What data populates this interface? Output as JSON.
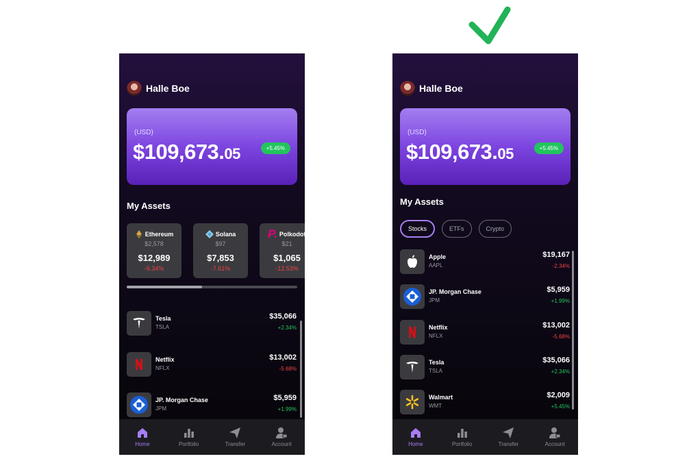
{
  "user": {
    "name": "Halle Boe"
  },
  "balance": {
    "currency": "(USD)",
    "main": "$109,673.",
    "cents": "05",
    "change": "+5.45%"
  },
  "section_title": "My Assets",
  "left": {
    "crypto_cards": [
      {
        "name": "Ethereum",
        "price": "$2,578",
        "value": "$12,989",
        "change": "-9.34%",
        "icon": "ethereum-icon"
      },
      {
        "name": "Solana",
        "price": "$97",
        "value": "$7,853",
        "change": "-7.61%",
        "icon": "solana-icon"
      },
      {
        "name": "Polkodot",
        "price": "$21",
        "value": "$1,065",
        "change": "-12.53%",
        "icon": "polkadot-icon"
      }
    ],
    "stocks": [
      {
        "name": "Tesla",
        "ticker": "TSLA",
        "value": "$35,066",
        "change": "+2.34%",
        "icon": "tesla-logo"
      },
      {
        "name": "Netflix",
        "ticker": "NFLX",
        "value": "$13,002",
        "change": "-5.68%",
        "icon": "netflix-logo"
      },
      {
        "name": "JP. Morgan Chase",
        "ticker": "JPM",
        "value": "$5,959",
        "change": "+1.99%",
        "icon": "chase-logo"
      }
    ]
  },
  "right": {
    "tabs": [
      "Stocks",
      "ETFs",
      "Crypto"
    ],
    "active_tab": "Stocks",
    "stocks": [
      {
        "name": "Apple",
        "ticker": "AAPL",
        "value": "$19,167",
        "change": "-2.34%",
        "icon": "apple-logo"
      },
      {
        "name": "JP. Morgan Chase",
        "ticker": "JPM",
        "value": "$5,959",
        "change": "+1.99%",
        "icon": "chase-logo"
      },
      {
        "name": "Netflix",
        "ticker": "NFLX",
        "value": "$13,002",
        "change": "-5.68%",
        "icon": "netflix-logo"
      },
      {
        "name": "Tesla",
        "ticker": "TSLA",
        "value": "$35,066",
        "change": "+2.34%",
        "icon": "tesla-logo"
      },
      {
        "name": "Walmart",
        "ticker": "WMT",
        "value": "$2,009",
        "change": "+5.45%",
        "icon": "walmart-logo"
      }
    ]
  },
  "nav": [
    {
      "label": "Home",
      "icon": "home-icon",
      "active": true
    },
    {
      "label": "Portfolio",
      "icon": "portfolio-icon",
      "active": false
    },
    {
      "label": "Transfer",
      "icon": "transfer-icon",
      "active": false
    },
    {
      "label": "Account",
      "icon": "account-icon",
      "active": false
    }
  ],
  "colors": {
    "accent": "#a77df5",
    "positive": "#22c55e",
    "negative": "#ef4444",
    "check": "#22b357"
  }
}
